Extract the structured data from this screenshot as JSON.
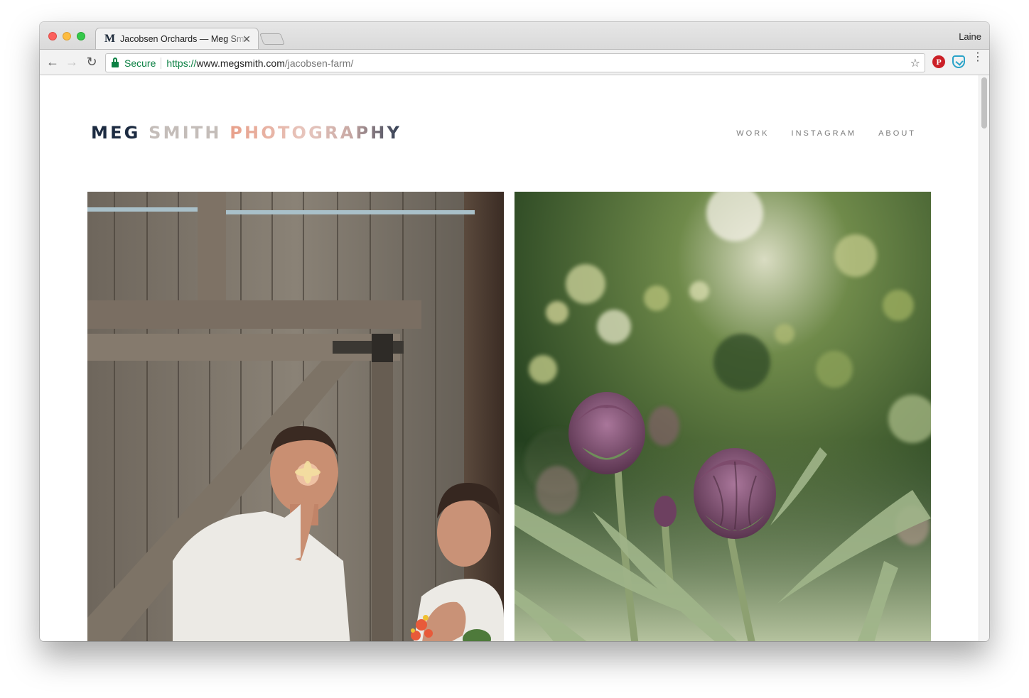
{
  "browser": {
    "tab_title": "Jacobsen Orchards — Meg Smith",
    "tab_favicon": "M",
    "close_glyph": "✕",
    "profile_name": "Laine",
    "security_label": "Secure",
    "url": {
      "scheme": "https://",
      "host": "www.megsmith.com",
      "path": "/jacobsen-farm/"
    },
    "nav_icons": [
      "back-arrow-icon",
      "forward-arrow-icon",
      "reload-icon"
    ],
    "extensions": [
      "pinterest-icon",
      "shield-icon",
      "menu-icon"
    ]
  },
  "site": {
    "logo": {
      "word1": "MEG",
      "word2": "SMITH",
      "word3": "PHOTOGRAPHY"
    },
    "nav": [
      "WORK",
      "INSTAGRAM",
      "ABOUT"
    ]
  },
  "colors": {
    "logo_navy": "#1c2b41",
    "logo_peach": "#e8a08a",
    "secure_green": "#0b8043"
  }
}
